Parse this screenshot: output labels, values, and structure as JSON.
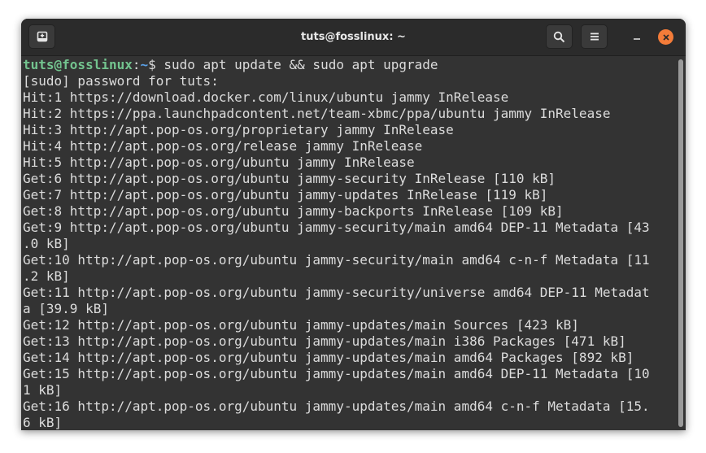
{
  "window": {
    "title": "tuts@fosslinux: ~"
  },
  "headerbar": {
    "new_tab_icon": "new-tab-icon",
    "search_icon": "search-icon",
    "menu_icon": "hamburger-menu-icon",
    "minimize_icon": "minimize-icon",
    "close_icon": "close-icon"
  },
  "colors": {
    "terminal_bg": "#333333",
    "prompt_user": "#73c48f",
    "prompt_path": "#5aa0e6",
    "text": "#dcdcdc",
    "close_button": "#f47c39"
  },
  "terminal": {
    "prompt": {
      "user": "tuts@fosslinux",
      "separator": ":",
      "path": "~",
      "symbol": "$ ",
      "command": "sudo apt update && sudo apt upgrade"
    },
    "lines": [
      "[sudo] password for tuts:",
      "Hit:1 https://download.docker.com/linux/ubuntu jammy InRelease",
      "Hit:2 https://ppa.launchpadcontent.net/team-xbmc/ppa/ubuntu jammy InRelease",
      "Hit:3 http://apt.pop-os.org/proprietary jammy InRelease",
      "Hit:4 http://apt.pop-os.org/release jammy InRelease",
      "Hit:5 http://apt.pop-os.org/ubuntu jammy InRelease",
      "Get:6 http://apt.pop-os.org/ubuntu jammy-security InRelease [110 kB]",
      "Get:7 http://apt.pop-os.org/ubuntu jammy-updates InRelease [119 kB]",
      "Get:8 http://apt.pop-os.org/ubuntu jammy-backports InRelease [109 kB]",
      "Get:9 http://apt.pop-os.org/ubuntu jammy-security/main amd64 DEP-11 Metadata [43",
      ".0 kB]",
      "Get:10 http://apt.pop-os.org/ubuntu jammy-security/main amd64 c-n-f Metadata [11",
      ".2 kB]",
      "Get:11 http://apt.pop-os.org/ubuntu jammy-security/universe amd64 DEP-11 Metadat",
      "a [39.9 kB]",
      "Get:12 http://apt.pop-os.org/ubuntu jammy-updates/main Sources [423 kB]",
      "Get:13 http://apt.pop-os.org/ubuntu jammy-updates/main i386 Packages [471 kB]",
      "Get:14 http://apt.pop-os.org/ubuntu jammy-updates/main amd64 Packages [892 kB]",
      "Get:15 http://apt.pop-os.org/ubuntu jammy-updates/main amd64 DEP-11 Metadata [10",
      "1 kB]",
      "Get:16 http://apt.pop-os.org/ubuntu jammy-updates/main amd64 c-n-f Metadata [15.",
      "6 kB]"
    ]
  }
}
